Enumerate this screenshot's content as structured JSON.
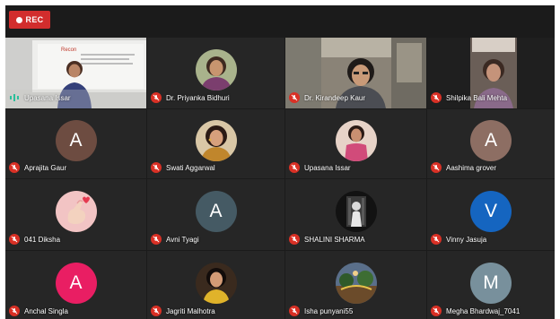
{
  "recording": {
    "label": "REC"
  },
  "colors": {
    "rec": "#d22d2d",
    "mic_off": "#d93025",
    "speaking_indicator": "#2bbf9a",
    "tile_bg": "#262626"
  },
  "participants": [
    {
      "name": "Upasana Issar",
      "type": "video",
      "mic": "active"
    },
    {
      "name": "Dr. Priyanka Bidhuri",
      "type": "photo",
      "mic": "muted"
    },
    {
      "name": "Dr. Kirandeep Kaur",
      "type": "video",
      "mic": "muted"
    },
    {
      "name": "Shilpika Bali Mehta",
      "type": "video",
      "mic": "muted"
    },
    {
      "name": "Aprajita Gaur",
      "type": "initial",
      "initial": "A",
      "avatar_color": "#6d4c41",
      "mic": "muted"
    },
    {
      "name": "Swati Aggarwal",
      "type": "photo",
      "mic": "muted"
    },
    {
      "name": "Upasana Issar",
      "type": "photo",
      "mic": "muted"
    },
    {
      "name": "Aashima grover",
      "type": "initial",
      "initial": "A",
      "avatar_color": "#8d6e63",
      "mic": "muted"
    },
    {
      "name": "041 Diksha",
      "type": "photo",
      "mic": "muted"
    },
    {
      "name": "Avni Tyagi",
      "type": "initial",
      "initial": "A",
      "avatar_color": "#455a64",
      "mic": "muted"
    },
    {
      "name": "SHALINI SHARMA",
      "type": "photo",
      "mic": "muted"
    },
    {
      "name": "Vinny Jasuja",
      "type": "initial",
      "initial": "V",
      "avatar_color": "#1565c0",
      "mic": "muted"
    },
    {
      "name": "Anchal Singla",
      "type": "initial",
      "initial": "A",
      "avatar_color": "#e91e63",
      "mic": "muted"
    },
    {
      "name": "Jagriti Malhotra",
      "type": "photo",
      "mic": "muted"
    },
    {
      "name": "Isha punyani55",
      "type": "photo",
      "mic": "muted"
    },
    {
      "name": "Megha Bhardwaj_7041",
      "type": "initial",
      "initial": "M",
      "avatar_color": "#78909c",
      "mic": "muted"
    }
  ]
}
